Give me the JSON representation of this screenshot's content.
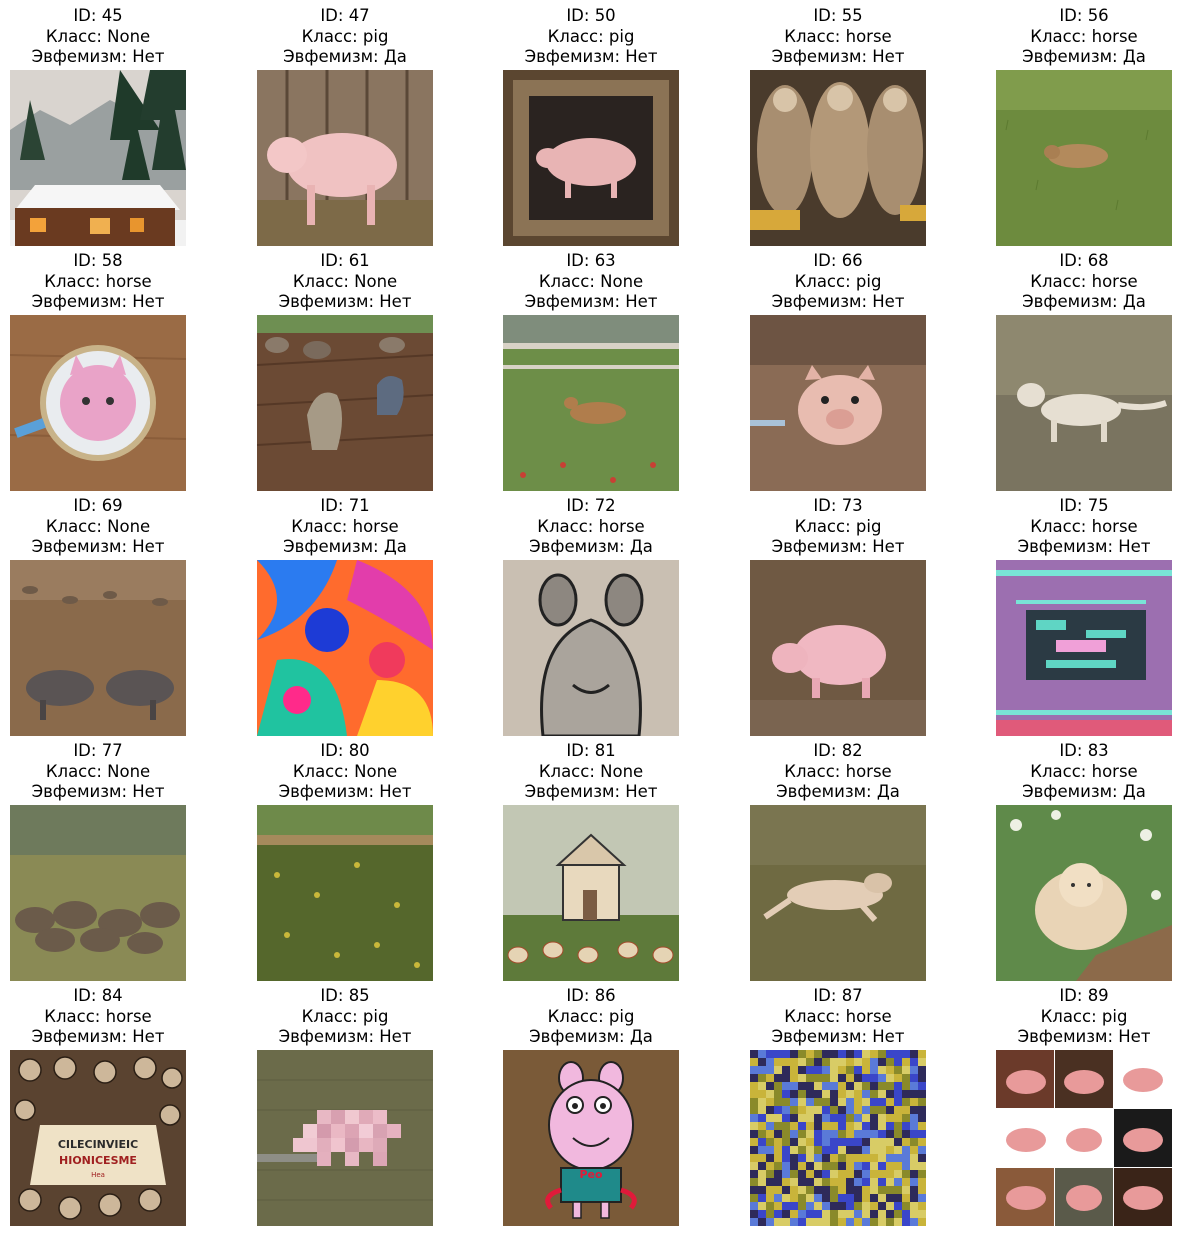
{
  "labels": {
    "id_prefix": "ID: ",
    "class_prefix": "Класс: ",
    "euphemism_prefix": "Эвфемизм: "
  },
  "cells": [
    {
      "id": "45",
      "cls": "None",
      "euph": "Нет",
      "scene": "cabin"
    },
    {
      "id": "47",
      "cls": "pig",
      "euph": "Да",
      "scene": "pig-fence"
    },
    {
      "id": "50",
      "cls": "pig",
      "euph": "Нет",
      "scene": "pig-frame"
    },
    {
      "id": "55",
      "cls": "horse",
      "euph": "Нет",
      "scene": "warriors"
    },
    {
      "id": "56",
      "cls": "horse",
      "euph": "Да",
      "scene": "field-animal"
    },
    {
      "id": "58",
      "cls": "horse",
      "euph": "Нет",
      "scene": "embroidery"
    },
    {
      "id": "61",
      "cls": "None",
      "euph": "Нет",
      "scene": "farmers"
    },
    {
      "id": "63",
      "cls": "None",
      "euph": "Нет",
      "scene": "deer"
    },
    {
      "id": "66",
      "cls": "pig",
      "euph": "Нет",
      "scene": "pig-mud"
    },
    {
      "id": "68",
      "cls": "horse",
      "euph": "Да",
      "scene": "white-dog"
    },
    {
      "id": "69",
      "cls": "None",
      "euph": "Нет",
      "scene": "boars"
    },
    {
      "id": "71",
      "cls": "horse",
      "euph": "Да",
      "scene": "psychedelic"
    },
    {
      "id": "72",
      "cls": "horse",
      "euph": "Да",
      "scene": "sketch-animal"
    },
    {
      "id": "73",
      "cls": "pig",
      "euph": "Нет",
      "scene": "pig-dirt"
    },
    {
      "id": "75",
      "cls": "horse",
      "euph": "Нет",
      "scene": "glitch"
    },
    {
      "id": "77",
      "cls": "None",
      "euph": "Нет",
      "scene": "bison"
    },
    {
      "id": "80",
      "cls": "None",
      "euph": "Нет",
      "scene": "crop-field"
    },
    {
      "id": "81",
      "cls": "None",
      "euph": "Нет",
      "scene": "house-chickens"
    },
    {
      "id": "82",
      "cls": "horse",
      "euph": "Да",
      "scene": "running-beast"
    },
    {
      "id": "83",
      "cls": "horse",
      "euph": "Да",
      "scene": "fluffy-cat"
    },
    {
      "id": "84",
      "cls": "horse",
      "euph": "Нет",
      "scene": "poster",
      "poster_text": [
        "CILECINVIEIC",
        "HIONICESME",
        "Hea"
      ]
    },
    {
      "id": "85",
      "cls": "pig",
      "euph": "Нет",
      "scene": "pixel-pig"
    },
    {
      "id": "86",
      "cls": "pig",
      "euph": "Да",
      "scene": "cartoon-pig",
      "shirt_text": "Peo"
    },
    {
      "id": "87",
      "cls": "horse",
      "euph": "Нет",
      "scene": "noise"
    },
    {
      "id": "89",
      "cls": "pig",
      "euph": "Нет",
      "scene": "pig-collage"
    }
  ]
}
